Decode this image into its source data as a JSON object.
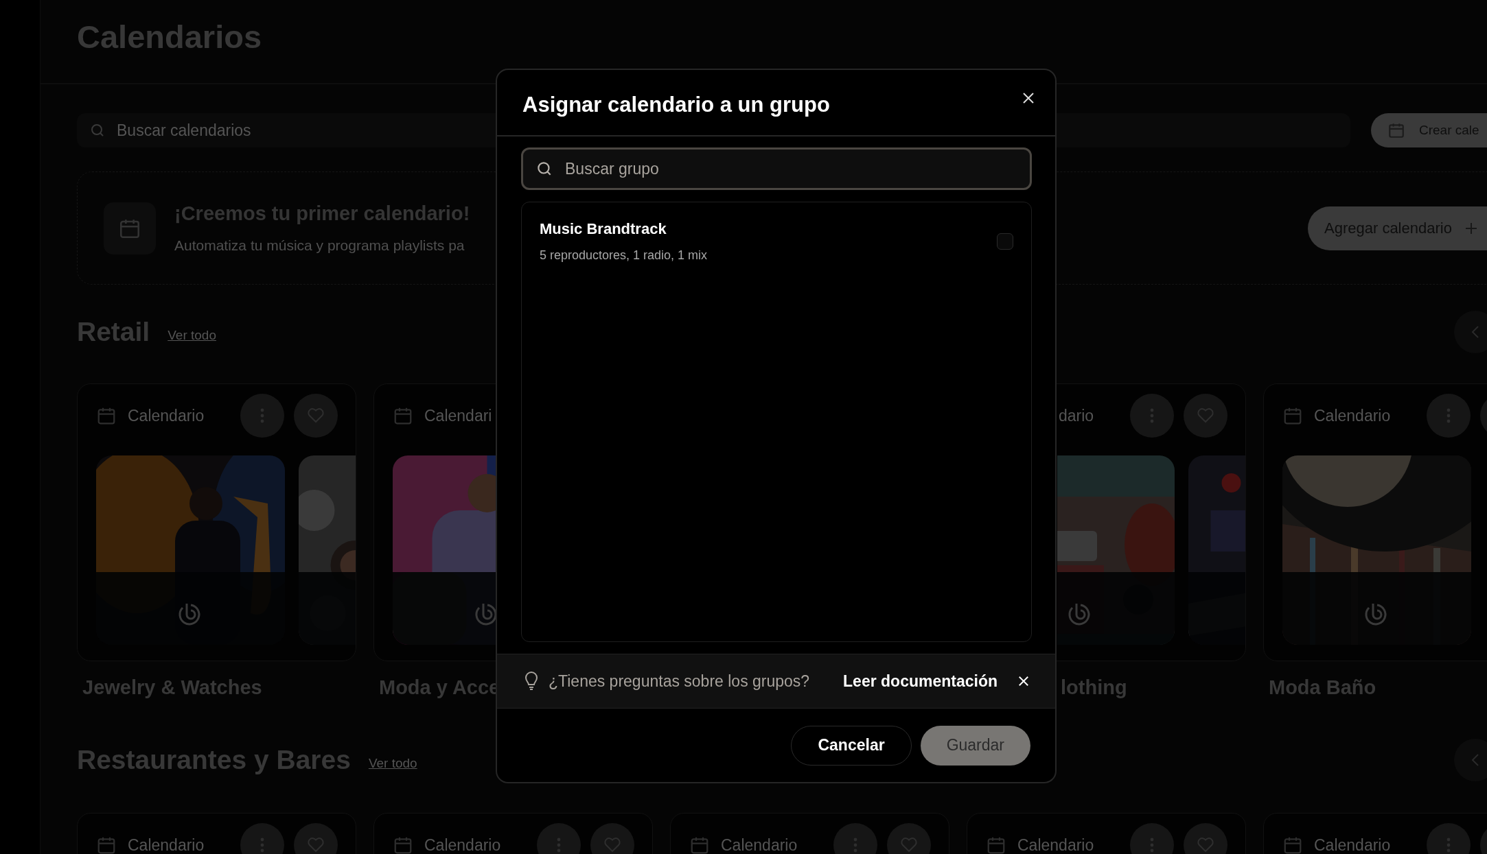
{
  "page": {
    "title": "Calendarios",
    "search": {
      "placeholder": "Buscar calendarios"
    },
    "create_button": "Crear cale"
  },
  "promo": {
    "title": "¡Creemos tu primer calendario!",
    "text": "Automatiza tu música y programa playlists pa",
    "button": "Agregar calendario"
  },
  "sections": [
    {
      "title": "Retail",
      "link": "Ver todo",
      "cards": [
        {
          "label": "Calendario",
          "name": "Jewelry & Watches"
        },
        {
          "label": "Calendari",
          "name": "Moda y Acce"
        },
        {
          "label": "dario",
          "name": "lothing"
        },
        {
          "label": "Calendario",
          "name": "Moda Baño"
        }
      ]
    },
    {
      "title": "Restaurantes y Bares",
      "link": "Ver todo",
      "cards": [
        {
          "label": "Calendario"
        },
        {
          "label": "Calendario"
        },
        {
          "label": "Calendario"
        },
        {
          "label": "Calendario"
        },
        {
          "label": "Calendario"
        }
      ]
    }
  ],
  "dialog": {
    "title": "Asignar calendario a un grupo",
    "search": {
      "placeholder": "Buscar grupo"
    },
    "groups": [
      {
        "name": "Music Brandtrack",
        "summary": "5 reproductores, 1 radio, 1 mix",
        "checked": false
      }
    ],
    "hint": {
      "text": "¿Tienes preguntas sobre los grupos?",
      "link": "Leer documentación"
    },
    "buttons": [
      {
        "label": "Cancelar",
        "kind": "secondary",
        "disabled": false
      },
      {
        "label": "Guardar",
        "kind": "primary",
        "disabled": true
      }
    ]
  }
}
